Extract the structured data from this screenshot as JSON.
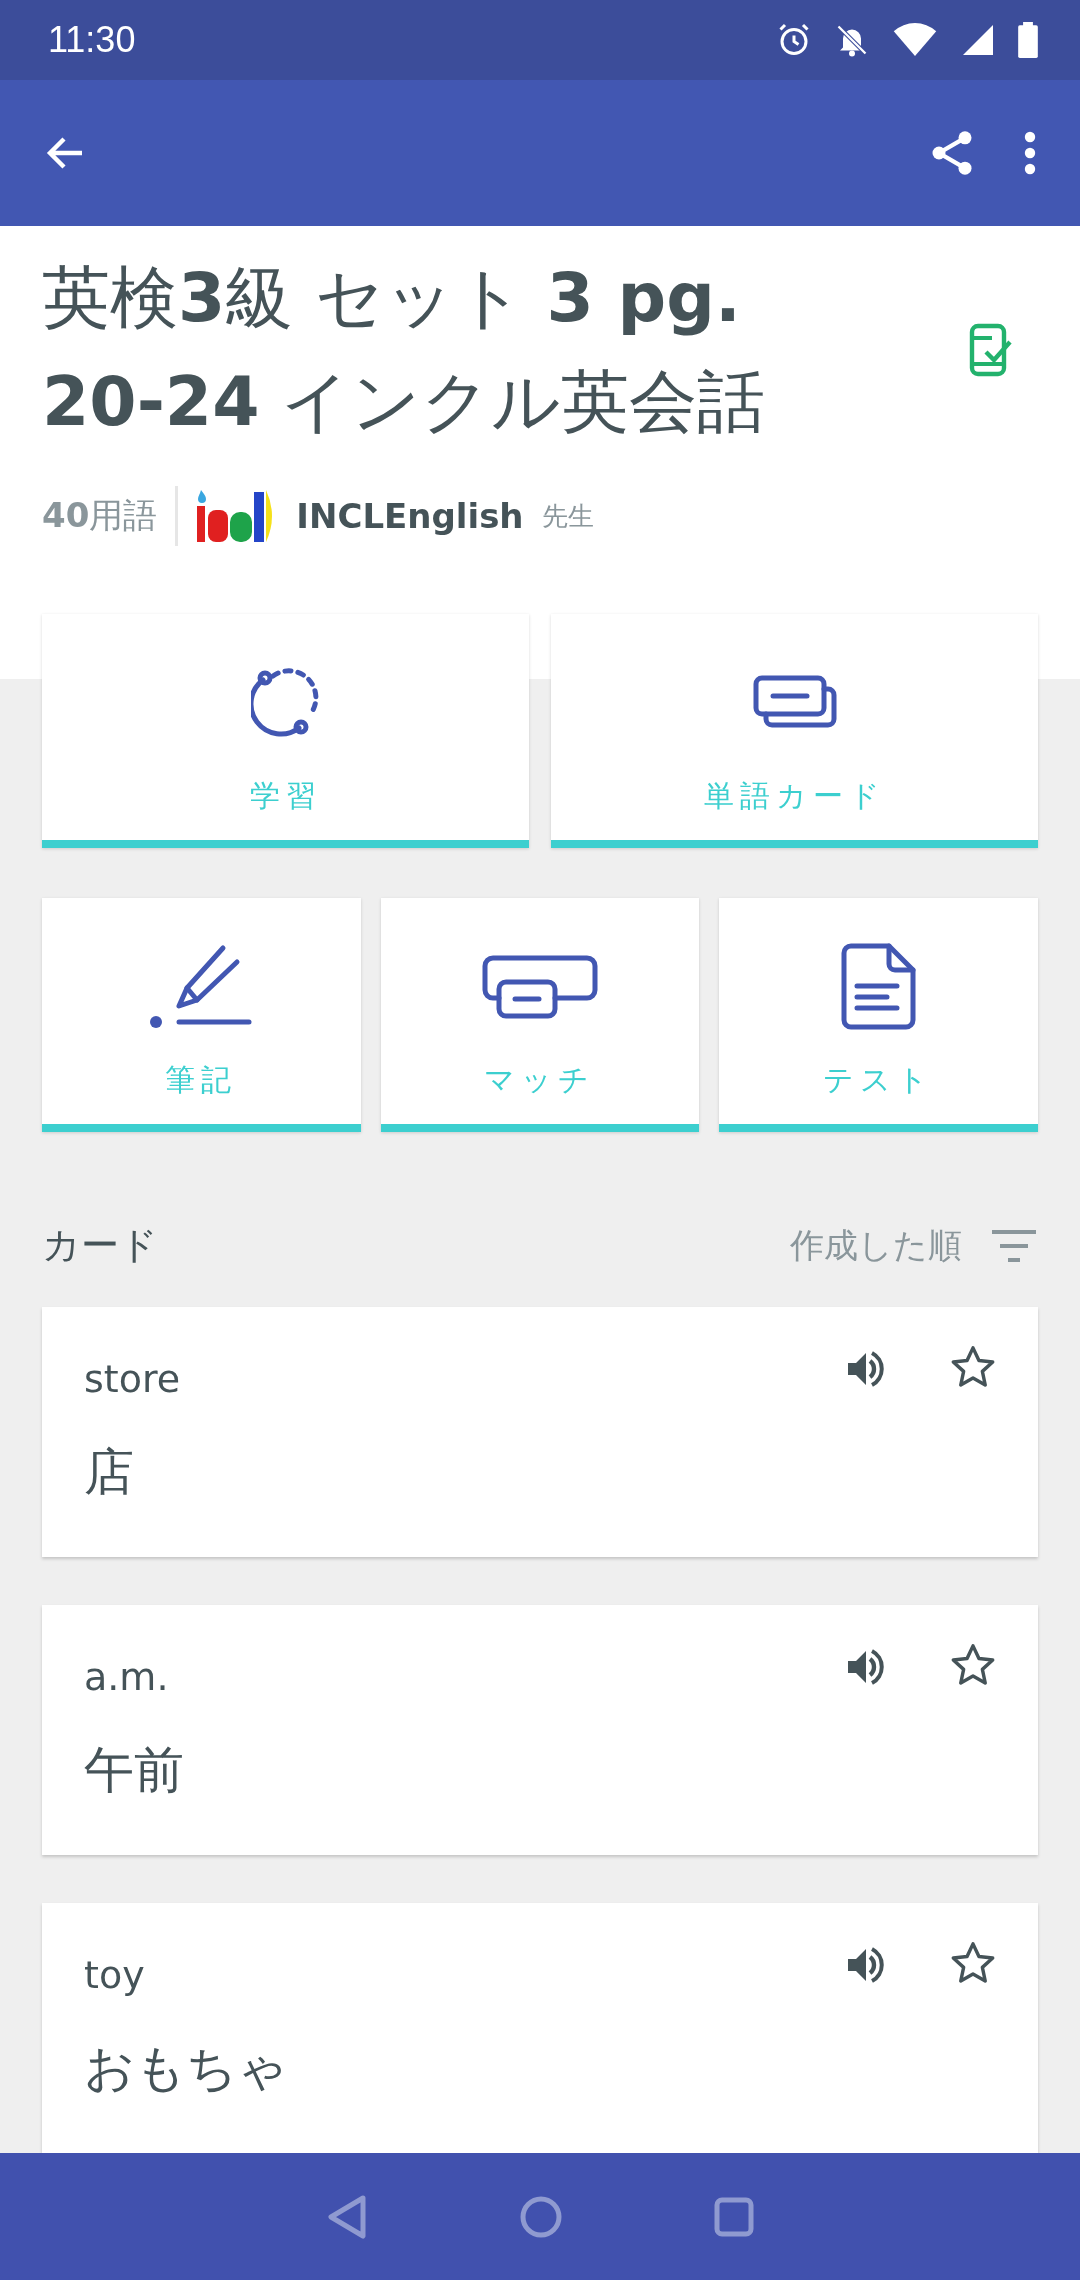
{
  "status_bar": {
    "time": "11:30"
  },
  "set": {
    "title": "英検**3**級 セット **3 pg. 20-24** インクル英会話",
    "term_count": "**40**用語",
    "author": "INCLEnglish",
    "role": "先生"
  },
  "modes": [
    {
      "kind": "learn",
      "label": "学習"
    },
    {
      "kind": "flashcards",
      "label": "単語カード"
    },
    {
      "kind": "write",
      "label": "筆記"
    },
    {
      "kind": "match",
      "label": "マッチ"
    },
    {
      "kind": "test",
      "label": "テスト"
    }
  ],
  "cards_section": {
    "heading": "カード",
    "sort": "作成した順"
  },
  "cards": [
    {
      "term": "store",
      "definition": "店",
      "starred": false
    },
    {
      "term": "a.m.",
      "definition": "午前",
      "starred": false
    },
    {
      "term": "toy",
      "definition": "おもちゃ",
      "starred": false
    }
  ]
}
